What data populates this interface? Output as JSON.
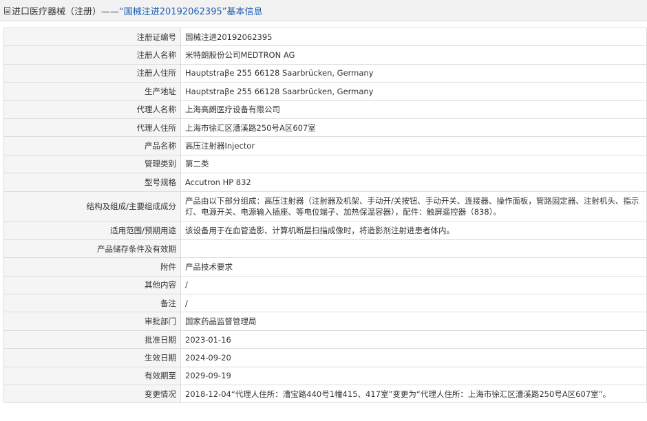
{
  "header": {
    "prefix": "进口医疗器械（注册）——",
    "title": "“国械注进20192062395”基本信息"
  },
  "rows": [
    {
      "label": "注册证编号",
      "value": "国械注进20192062395"
    },
    {
      "label": "注册人名称",
      "value": "米特朗股份公司MEDTRON AG"
    },
    {
      "label": "注册人住所",
      "value": "Hauptstraβe 255 66128 Saarbrücken, Germany"
    },
    {
      "label": "生产地址",
      "value": "Hauptstraβe 255 66128 Saarbrücken, Germany"
    },
    {
      "label": "代理人名称",
      "value": "上海高朗医疗设备有限公司"
    },
    {
      "label": "代理人住所",
      "value": "上海市徐汇区漕溪路250号A区607室"
    },
    {
      "label": "产品名称",
      "value": "高压注射器Injector"
    },
    {
      "label": "管理类别",
      "value": "第二类"
    },
    {
      "label": "型号规格",
      "value": "Accutron HP 832"
    },
    {
      "label": "结构及组成/主要组成成分",
      "value": "产品由以下部分组成：高压注射器（注射器及机架、手动开/关按钮、手动开关、连接器、操作面板，管路固定器、注射机头、指示灯、电源开关、电源输入插座、等电位端子、加热保温容器），配件：触屏遥控器（838）。"
    },
    {
      "label": "适用范围/预期用途",
      "value": "该设备用于在血管造影、计算机断层扫描成像时，将造影剂注射进患者体内。"
    },
    {
      "label": "产品储存条件及有效期",
      "value": ""
    },
    {
      "label": "附件",
      "value": "产品技术要求"
    },
    {
      "label": "其他内容",
      "value": "/"
    },
    {
      "label": "备注",
      "value": "/"
    },
    {
      "label": "审批部门",
      "value": "国家药品监督管理局"
    },
    {
      "label": "批准日期",
      "value": "2023-01-16"
    },
    {
      "label": "生效日期",
      "value": "2024-09-20"
    },
    {
      "label": "有效期至",
      "value": "2029-09-19"
    },
    {
      "label": "变更情况",
      "value": "2018-12-04“代理人住所：漕宝路440号1幢415、417室”变更为“代理人住所：上海市徐汇区漕溪路250号A区607室”。"
    }
  ]
}
